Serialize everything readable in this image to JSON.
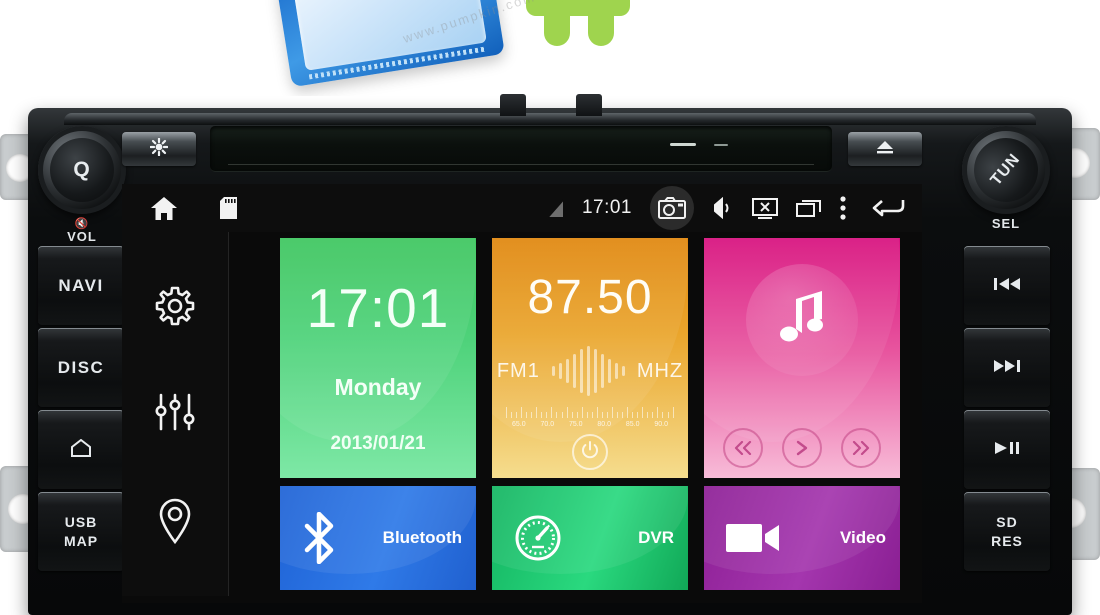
{
  "promo": {
    "watermark": "www.pumpkin.com",
    "chip_icon": "cpu-chip-icon",
    "robot_icon": "android-robot-icon"
  },
  "unit": {
    "left_knob": {
      "label": "Q",
      "icon": "rotary-knob"
    },
    "right_knob": {
      "label": "TUN",
      "icon": "rotary-knob"
    },
    "vol_label": "VOL",
    "vol_mute_icon": "mute-speaker-icon",
    "sel_label": "SEL",
    "brightness_icon": "brightness-asterisk-icon",
    "eject_icon": "eject-icon",
    "left_buttons": [
      {
        "label": "NAVI",
        "icon": "navi-button"
      },
      {
        "label": "DISC",
        "icon": "disc-button"
      },
      {
        "label": "",
        "icon": "home-pentagon-icon"
      },
      {
        "label": "USB\nMAP",
        "line1": "USB",
        "line2": "MAP",
        "icon": "usb-map-button"
      }
    ],
    "right_buttons": [
      {
        "label": "",
        "icon": "previous-track-icon"
      },
      {
        "label": "",
        "icon": "next-track-icon"
      },
      {
        "label": "",
        "icon": "play-pause-icon"
      },
      {
        "line1": "SD",
        "line2": "RES",
        "icon": "sd-res-button"
      }
    ]
  },
  "status_bar": {
    "home_icon": "home-icon",
    "sd_icon": "sd-card-icon",
    "signal_icon": "signal-off-icon",
    "clock": "17:01",
    "camera_icon": "camera-icon",
    "volume_icon": "volume-icon",
    "screen_off_icon": "screen-off-icon",
    "recents_icon": "recent-apps-icon",
    "menu_icon": "overflow-menu-icon",
    "back_icon": "back-arrow-icon"
  },
  "app_rail": [
    {
      "name": "settings",
      "icon": "gear-icon"
    },
    {
      "name": "equalizer",
      "icon": "sliders-icon"
    },
    {
      "name": "navigation",
      "icon": "location-pin-icon"
    }
  ],
  "tiles": {
    "clock": {
      "time": "17:01",
      "day": "Monday",
      "date": "2013/01/21",
      "color": "#4ed27a"
    },
    "radio": {
      "frequency": "87.50",
      "band": "FM1",
      "unit": "MHZ",
      "scale": [
        "65.0",
        "70.0",
        "75.0",
        "80.0",
        "85.0",
        "90.0"
      ],
      "power_icon": "power-icon",
      "color": "#eaa52c"
    },
    "music": {
      "icon": "music-note-icon",
      "prev_icon": "previous-track-icon",
      "play_icon": "play-icon",
      "next_icon": "next-track-icon",
      "color": "#e8569f"
    },
    "bluetooth": {
      "label": "Bluetooth",
      "icon": "bluetooth-icon",
      "color": "#2f7ae8"
    },
    "dvr": {
      "label": "DVR",
      "icon": "speedometer-icon",
      "color": "#2ad97f"
    },
    "video": {
      "label": "Video",
      "icon": "camcorder-icon",
      "color": "#a436ae"
    }
  }
}
